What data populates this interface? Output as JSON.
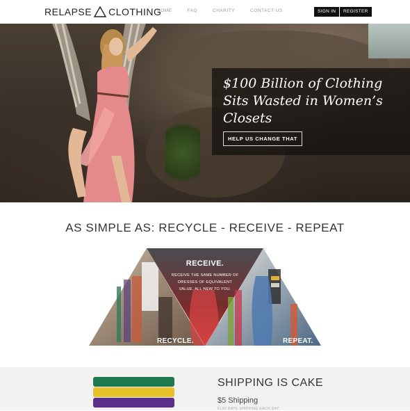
{
  "header": {
    "logo_left": "RELAPSE",
    "logo_right": "CLOTHING",
    "nav": [
      "HOME",
      "FAQ",
      "CHARITY",
      "CONTACT US"
    ],
    "sign_in": "SIGN IN",
    "register": "REGISTER"
  },
  "hero": {
    "heading": "$100 Billion of Clothing Sits Wasted in Women’s Closets",
    "cta": "HELP US CHANGE THAT"
  },
  "steps": {
    "title": "AS SIMPLE AS: RECYCLE - RECEIVE - REPEAT",
    "receive_title": "RECEIVE.",
    "receive_desc": "RECEIVE THE SAME NUMBER OF DRESSES OF EQUIVALENT VALUE. ALL NEW TO YOU.",
    "recycle_label": "RECYCLE.",
    "repeat_label": "REPEAT."
  },
  "shipping": {
    "title": "SHIPPING IS CAKE",
    "price": "$5 Shipping",
    "note": "FLAT RATE SHIPPING EACH DAY"
  },
  "colors": {
    "dark": "#111111",
    "panel": "#141210",
    "green": "#1e7a4e",
    "yellow": "#e8c22a",
    "purple": "#5a2f8a"
  }
}
